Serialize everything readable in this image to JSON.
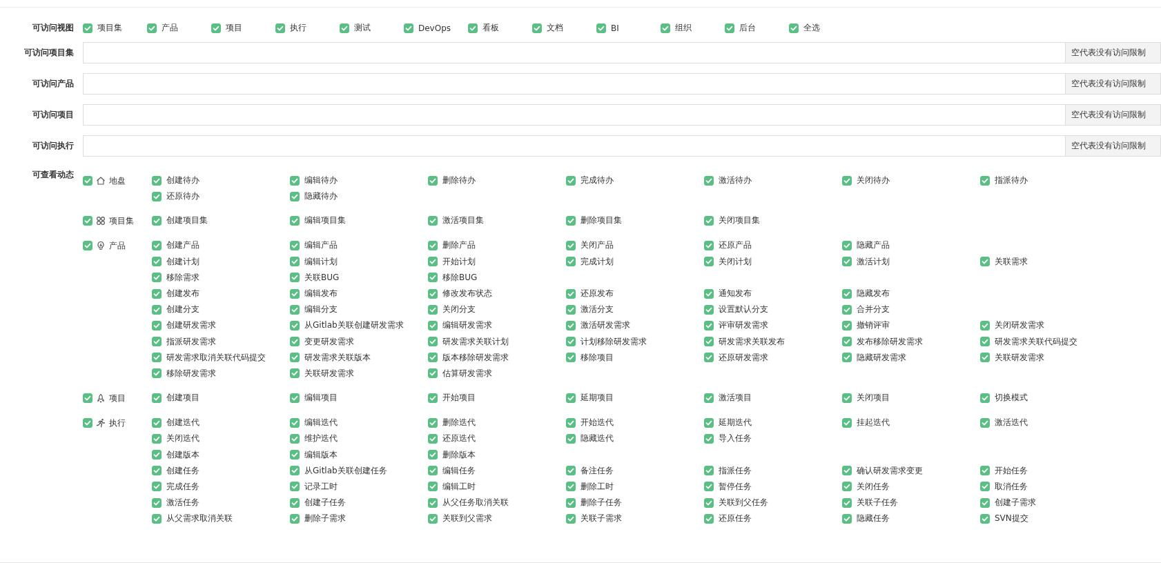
{
  "views": {
    "label": "可访问视图",
    "items": [
      {
        "label": "项目集",
        "checked": true
      },
      {
        "label": "产品",
        "checked": true
      },
      {
        "label": "项目",
        "checked": true
      },
      {
        "label": "执行",
        "checked": true
      },
      {
        "label": "测试",
        "checked": true
      },
      {
        "label": "DevOps",
        "checked": true
      },
      {
        "label": "看板",
        "checked": true
      },
      {
        "label": "文档",
        "checked": true
      },
      {
        "label": "BI",
        "checked": true
      },
      {
        "label": "组织",
        "checked": true
      },
      {
        "label": "后台",
        "checked": true
      },
      {
        "label": "全选",
        "checked": true
      }
    ]
  },
  "access_fields": [
    {
      "label": "可访问项目集",
      "addon": "空代表没有访问限制"
    },
    {
      "label": "可访问产品",
      "addon": "空代表没有访问限制"
    },
    {
      "label": "可访问项目",
      "addon": "空代表没有访问限制"
    },
    {
      "label": "可访问执行",
      "addon": "空代表没有访问限制"
    }
  ],
  "dynamics": {
    "label": "可查看动态",
    "groups": [
      {
        "name": "地盘",
        "checked": true,
        "rows": [
          [
            {
              "label": "创建待办",
              "checked": true
            },
            {
              "label": "编辑待办",
              "checked": true
            },
            {
              "label": "删除待办",
              "checked": true
            },
            {
              "label": "完成待办",
              "checked": true
            },
            {
              "label": "激活待办",
              "checked": true
            },
            {
              "label": "关闭待办",
              "checked": true
            },
            {
              "label": "指派待办",
              "checked": true
            }
          ],
          [
            {
              "label": "还原待办",
              "checked": true
            },
            {
              "label": "隐藏待办",
              "checked": true
            }
          ]
        ]
      },
      {
        "name": "项目集",
        "checked": true,
        "rows": [
          [
            {
              "label": "创建项目集",
              "checked": true
            },
            {
              "label": "编辑项目集",
              "checked": true
            },
            {
              "label": "激活项目集",
              "checked": true
            },
            {
              "label": "删除项目集",
              "checked": true
            },
            {
              "label": "关闭项目集",
              "checked": true
            }
          ]
        ]
      },
      {
        "name": "产品",
        "checked": true,
        "rows": [
          [
            {
              "label": "创建产品",
              "checked": true
            },
            {
              "label": "编辑产品",
              "checked": true
            },
            {
              "label": "删除产品",
              "checked": true
            },
            {
              "label": "关闭产品",
              "checked": true
            },
            {
              "label": "还原产品",
              "checked": true
            },
            {
              "label": "隐藏产品",
              "checked": true
            }
          ],
          [
            {
              "label": "创建计划",
              "checked": true
            },
            {
              "label": "编辑计划",
              "checked": true
            },
            {
              "label": "开始计划",
              "checked": true
            },
            {
              "label": "完成计划",
              "checked": true
            },
            {
              "label": "关闭计划",
              "checked": true
            },
            {
              "label": "激活计划",
              "checked": true
            },
            {
              "label": "关联需求",
              "checked": true
            }
          ],
          [
            {
              "label": "移除需求",
              "checked": true
            },
            {
              "label": "关联BUG",
              "checked": true
            },
            {
              "label": "移除BUG",
              "checked": true
            }
          ],
          [
            {
              "label": "创建发布",
              "checked": true
            },
            {
              "label": "编辑发布",
              "checked": true
            },
            {
              "label": "修改发布状态",
              "checked": true
            },
            {
              "label": "还原发布",
              "checked": true
            },
            {
              "label": "通知发布",
              "checked": true
            },
            {
              "label": "隐藏发布",
              "checked": true
            }
          ],
          [
            {
              "label": "创建分支",
              "checked": true
            },
            {
              "label": "编辑分支",
              "checked": true
            },
            {
              "label": "关闭分支",
              "checked": true
            },
            {
              "label": "激活分支",
              "checked": true
            },
            {
              "label": "设置默认分支",
              "checked": true
            },
            {
              "label": "合并分支",
              "checked": true
            }
          ],
          [
            {
              "label": "创建研发需求",
              "checked": true
            },
            {
              "label": "从Gitlab关联创建研发需求",
              "checked": true
            },
            {
              "label": "编辑研发需求",
              "checked": true
            },
            {
              "label": "激活研发需求",
              "checked": true
            },
            {
              "label": "评审研发需求",
              "checked": true
            },
            {
              "label": "撤销评审",
              "checked": true
            },
            {
              "label": "关闭研发需求",
              "checked": true
            }
          ],
          [
            {
              "label": "指派研发需求",
              "checked": true
            },
            {
              "label": "变更研发需求",
              "checked": true
            },
            {
              "label": "研发需求关联计划",
              "checked": true
            },
            {
              "label": "计划移除研发需求",
              "checked": true
            },
            {
              "label": "研发需求关联发布",
              "checked": true
            },
            {
              "label": "发布移除研发需求",
              "checked": true
            },
            {
              "label": "研发需求关联代码提交",
              "checked": true
            }
          ],
          [
            {
              "label": "研发需求取消关联代码提交",
              "checked": true
            },
            {
              "label": "研发需求关联版本",
              "checked": true
            },
            {
              "label": "版本移除研发需求",
              "checked": true
            },
            {
              "label": "移除项目",
              "checked": true
            },
            {
              "label": "还原研发需求",
              "checked": true
            },
            {
              "label": "隐藏研发需求",
              "checked": true
            },
            {
              "label": "关联研发需求",
              "checked": true
            }
          ],
          [
            {
              "label": "移除研发需求",
              "checked": true
            },
            {
              "label": "关联研发需求",
              "checked": true
            },
            {
              "label": "估算研发需求",
              "checked": true
            }
          ]
        ]
      },
      {
        "name": "项目",
        "checked": true,
        "rows": [
          [
            {
              "label": "创建项目",
              "checked": true
            },
            {
              "label": "编辑项目",
              "checked": true
            },
            {
              "label": "开始项目",
              "checked": true
            },
            {
              "label": "延期项目",
              "checked": true
            },
            {
              "label": "激活项目",
              "checked": true
            },
            {
              "label": "关闭项目",
              "checked": true
            },
            {
              "label": "切换模式",
              "checked": true
            }
          ]
        ]
      },
      {
        "name": "执行",
        "checked": true,
        "rows": [
          [
            {
              "label": "创建迭代",
              "checked": true
            },
            {
              "label": "编辑迭代",
              "checked": true
            },
            {
              "label": "删除迭代",
              "checked": true
            },
            {
              "label": "开始迭代",
              "checked": true
            },
            {
              "label": "延期迭代",
              "checked": true
            },
            {
              "label": "挂起迭代",
              "checked": true
            },
            {
              "label": "激活迭代",
              "checked": true
            }
          ],
          [
            {
              "label": "关闭迭代",
              "checked": true
            },
            {
              "label": "维护迭代",
              "checked": true
            },
            {
              "label": "还原迭代",
              "checked": true
            },
            {
              "label": "隐藏迭代",
              "checked": true
            },
            {
              "label": "导入任务",
              "checked": true
            }
          ],
          [
            {
              "label": "创建版本",
              "checked": true
            },
            {
              "label": "编辑版本",
              "checked": true
            },
            {
              "label": "删除版本",
              "checked": true
            }
          ],
          [
            {
              "label": "创建任务",
              "checked": true
            },
            {
              "label": "从Gitlab关联创建任务",
              "checked": true
            },
            {
              "label": "编辑任务",
              "checked": true
            },
            {
              "label": "备注任务",
              "checked": true
            },
            {
              "label": "指派任务",
              "checked": true
            },
            {
              "label": "确认研发需求变更",
              "checked": true
            },
            {
              "label": "开始任务",
              "checked": true
            }
          ],
          [
            {
              "label": "完成任务",
              "checked": true
            },
            {
              "label": "记录工时",
              "checked": true
            },
            {
              "label": "编辑工时",
              "checked": true
            },
            {
              "label": "删除工时",
              "checked": true
            },
            {
              "label": "暂停任务",
              "checked": true
            },
            {
              "label": "关闭任务",
              "checked": true
            },
            {
              "label": "取消任务",
              "checked": true
            }
          ],
          [
            {
              "label": "激活任务",
              "checked": true
            },
            {
              "label": "创建子任务",
              "checked": true
            },
            {
              "label": "从父任务取消关联",
              "checked": true
            },
            {
              "label": "删除子任务",
              "checked": true
            },
            {
              "label": "关联到父任务",
              "checked": true
            },
            {
              "label": "关联子任务",
              "checked": true
            },
            {
              "label": "创建子需求",
              "checked": true
            }
          ],
          [
            {
              "label": "从父需求取消关联",
              "checked": true
            },
            {
              "label": "删除子需求",
              "checked": true
            },
            {
              "label": "关联到父需求",
              "checked": true
            },
            {
              "label": "关联子需求",
              "checked": true
            },
            {
              "label": "还原任务",
              "checked": true
            },
            {
              "label": "隐藏任务",
              "checked": true
            },
            {
              "label": "SVN提交",
              "checked": true
            }
          ]
        ]
      }
    ]
  }
}
